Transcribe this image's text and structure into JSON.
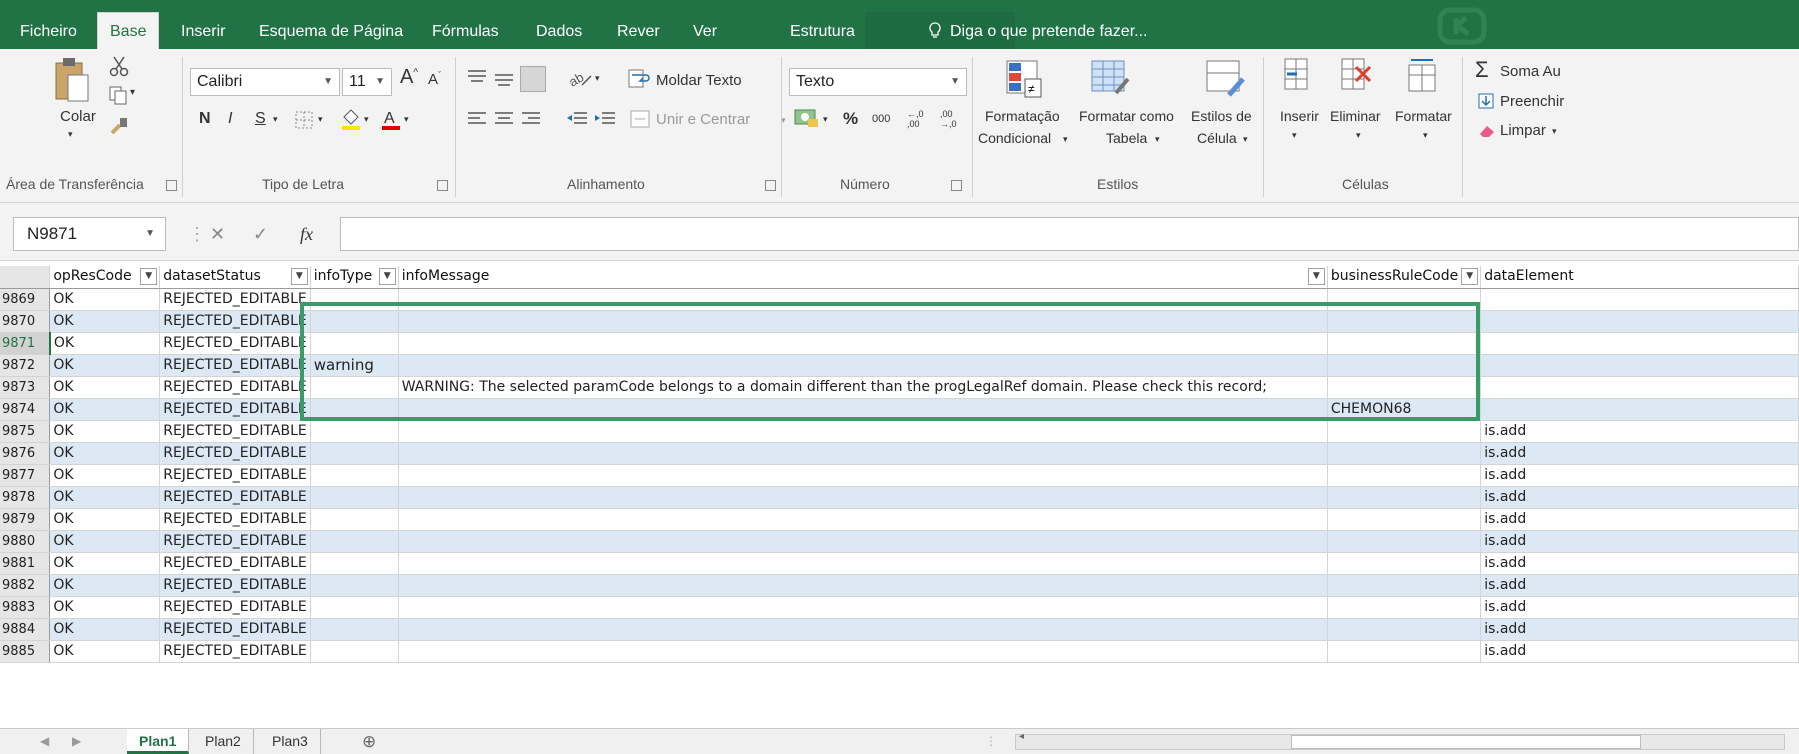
{
  "tabs": [
    {
      "label": "Ficheiro"
    },
    {
      "label": "Base"
    },
    {
      "label": "Inserir"
    },
    {
      "label": "Esquema de Página"
    },
    {
      "label": "Fórmulas"
    },
    {
      "label": "Dados"
    },
    {
      "label": "Rever"
    },
    {
      "label": "Ver"
    },
    {
      "label": "Estrutura"
    }
  ],
  "tell_me": "Diga o que pretende fazer...",
  "colors": {
    "brand": "#217346",
    "band": "#dde8f5",
    "highlight": "#3a9a6a"
  },
  "ribbon": {
    "clipboard": {
      "paste": "Colar",
      "group": "Área de Transferência"
    },
    "font": {
      "name": "Calibri",
      "size": "11",
      "bold": "N",
      "italic": "I",
      "underline": "S",
      "group": "Tipo de Letra"
    },
    "alignment": {
      "wrap": "Moldar Texto",
      "merge": "Unir e Centrar",
      "group": "Alinhamento"
    },
    "number": {
      "format": "Texto",
      "percent": "%",
      "thousands": "000",
      "inc_decimal": "←,0 ,00",
      "dec_decimal": ",00 →,0",
      "group": "Número"
    },
    "styles": {
      "cond_line1": "Formatação",
      "cond_line2": "Condicional",
      "table_line1": "Formatar como",
      "table_line2": "Tabela",
      "cell_line1": "Estilos de",
      "cell_line2": "Célula",
      "group": "Estilos"
    },
    "cells": {
      "insert": "Inserir",
      "delete": "Eliminar",
      "format": "Formatar",
      "group": "Células"
    },
    "editing": {
      "autosum": "Soma Au",
      "fill": "Preenchir",
      "clear": "Limpar"
    }
  },
  "formula_bar": {
    "namebox": "N9871",
    "fx": "fx",
    "value": ""
  },
  "columns": [
    "opResCode",
    "datasetStatus",
    "infoType",
    "infoMessage",
    "businessRuleCode",
    "dataElement"
  ],
  "rows": [
    {
      "n": "9869",
      "op": "OK",
      "status": "REJECTED_EDITABLE",
      "type": "",
      "msg": "",
      "brc": "",
      "de": ""
    },
    {
      "n": "9870",
      "op": "OK",
      "status": "REJECTED_EDITABLE",
      "type": "",
      "msg": "",
      "brc": "",
      "de": ""
    },
    {
      "n": "9871",
      "op": "OK",
      "status": "REJECTED_EDITABLE",
      "type": "",
      "msg": "",
      "brc": "",
      "de": ""
    },
    {
      "n": "9872",
      "op": "OK",
      "status": "REJECTED_EDITABLE",
      "type": "warning",
      "msg": "",
      "brc": "",
      "de": ""
    },
    {
      "n": "9873",
      "op": "OK",
      "status": "REJECTED_EDITABLE",
      "type": "",
      "msg": "WARNING: The selected paramCode belongs to a domain different than the progLegalRef domain. Please check this record;",
      "brc": "",
      "de": ""
    },
    {
      "n": "9874",
      "op": "OK",
      "status": "REJECTED_EDITABLE",
      "type": "",
      "msg": "",
      "brc": "CHEMON68",
      "de": ""
    },
    {
      "n": "9875",
      "op": "OK",
      "status": "REJECTED_EDITABLE",
      "type": "",
      "msg": "",
      "brc": "",
      "de": "is.add"
    },
    {
      "n": "9876",
      "op": "OK",
      "status": "REJECTED_EDITABLE",
      "type": "",
      "msg": "",
      "brc": "",
      "de": "is.add"
    },
    {
      "n": "9877",
      "op": "OK",
      "status": "REJECTED_EDITABLE",
      "type": "",
      "msg": "",
      "brc": "",
      "de": "is.add"
    },
    {
      "n": "9878",
      "op": "OK",
      "status": "REJECTED_EDITABLE",
      "type": "",
      "msg": "",
      "brc": "",
      "de": "is.add"
    },
    {
      "n": "9879",
      "op": "OK",
      "status": "REJECTED_EDITABLE",
      "type": "",
      "msg": "",
      "brc": "",
      "de": "is.add"
    },
    {
      "n": "9880",
      "op": "OK",
      "status": "REJECTED_EDITABLE",
      "type": "",
      "msg": "",
      "brc": "",
      "de": "is.add"
    },
    {
      "n": "9881",
      "op": "OK",
      "status": "REJECTED_EDITABLE",
      "type": "",
      "msg": "",
      "brc": "",
      "de": "is.add"
    },
    {
      "n": "9882",
      "op": "OK",
      "status": "REJECTED_EDITABLE",
      "type": "",
      "msg": "",
      "brc": "",
      "de": "is.add"
    },
    {
      "n": "9883",
      "op": "OK",
      "status": "REJECTED_EDITABLE",
      "type": "",
      "msg": "",
      "brc": "",
      "de": "is.add"
    },
    {
      "n": "9884",
      "op": "OK",
      "status": "REJECTED_EDITABLE",
      "type": "",
      "msg": "",
      "brc": "",
      "de": "is.add"
    },
    {
      "n": "9885",
      "op": "OK",
      "status": "REJECTED_EDITABLE",
      "type": "",
      "msg": "",
      "brc": "",
      "de": "is.add"
    }
  ],
  "selected_row": "9871",
  "sheets": [
    {
      "label": "Plan1"
    },
    {
      "label": "Plan2"
    },
    {
      "label": "Plan3"
    }
  ],
  "add_sheet": "⊕"
}
